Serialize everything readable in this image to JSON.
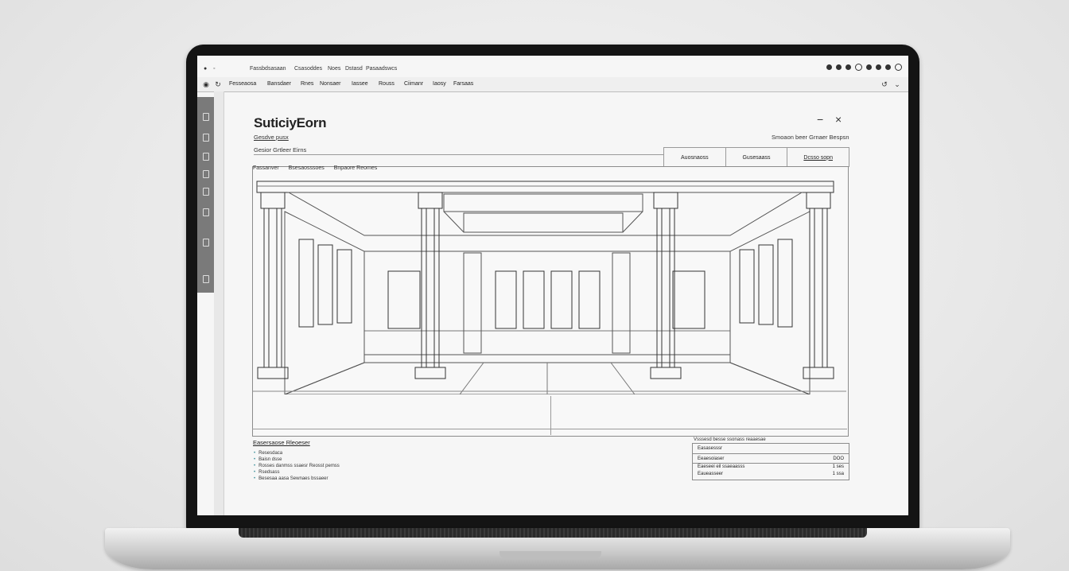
{
  "app": {
    "menu": [
      "Fassbdsasaan",
      "Csasoddes",
      "Noes",
      "Dstasd",
      "Pasaadswcs"
    ],
    "toolbar": [
      "Fesseaosa",
      "Bansdaer",
      "Rnes",
      "Nonsaer",
      "Iassee",
      "Rouss",
      "Ciimanr",
      "Iaosy",
      "Farsaas"
    ]
  },
  "panel": {
    "title": "SuticiyEorn",
    "subtitle": "Gesdve pusx",
    "section_label": "Gesior Grtleer Eirns",
    "search_link": "Smoaon beer Grnaer Bespsn",
    "min_icon": "−",
    "close_icon": "×",
    "tabs": [
      "Auosnaoss",
      "Gusesaass",
      "Dcsso sopn"
    ],
    "filters": [
      "Fassanver",
      "Bsesaosssoes",
      "Bnpaore Reomes"
    ]
  },
  "notes": {
    "title": "Easersaose Rleoeser",
    "items": [
      "Resesdaca",
      "Baisn dsse",
      "Rosses danmss ssaesr Reosst pemss",
      "Rsedsass",
      "Besesaa aasa Sewnaes bssaeer"
    ]
  },
  "table": {
    "caption": "Vsssesd besse ssonass reaaesae",
    "rows": [
      {
        "label": "Easasesssr",
        "value": ""
      },
      {
        "label": "Eeaesoiaser",
        "value": "DOO"
      },
      {
        "label": "Eaeseei eil ssaeaasss",
        "value": "1 ses"
      },
      {
        "label": "Eaueasseer",
        "value": "1 ssa"
      }
    ]
  }
}
